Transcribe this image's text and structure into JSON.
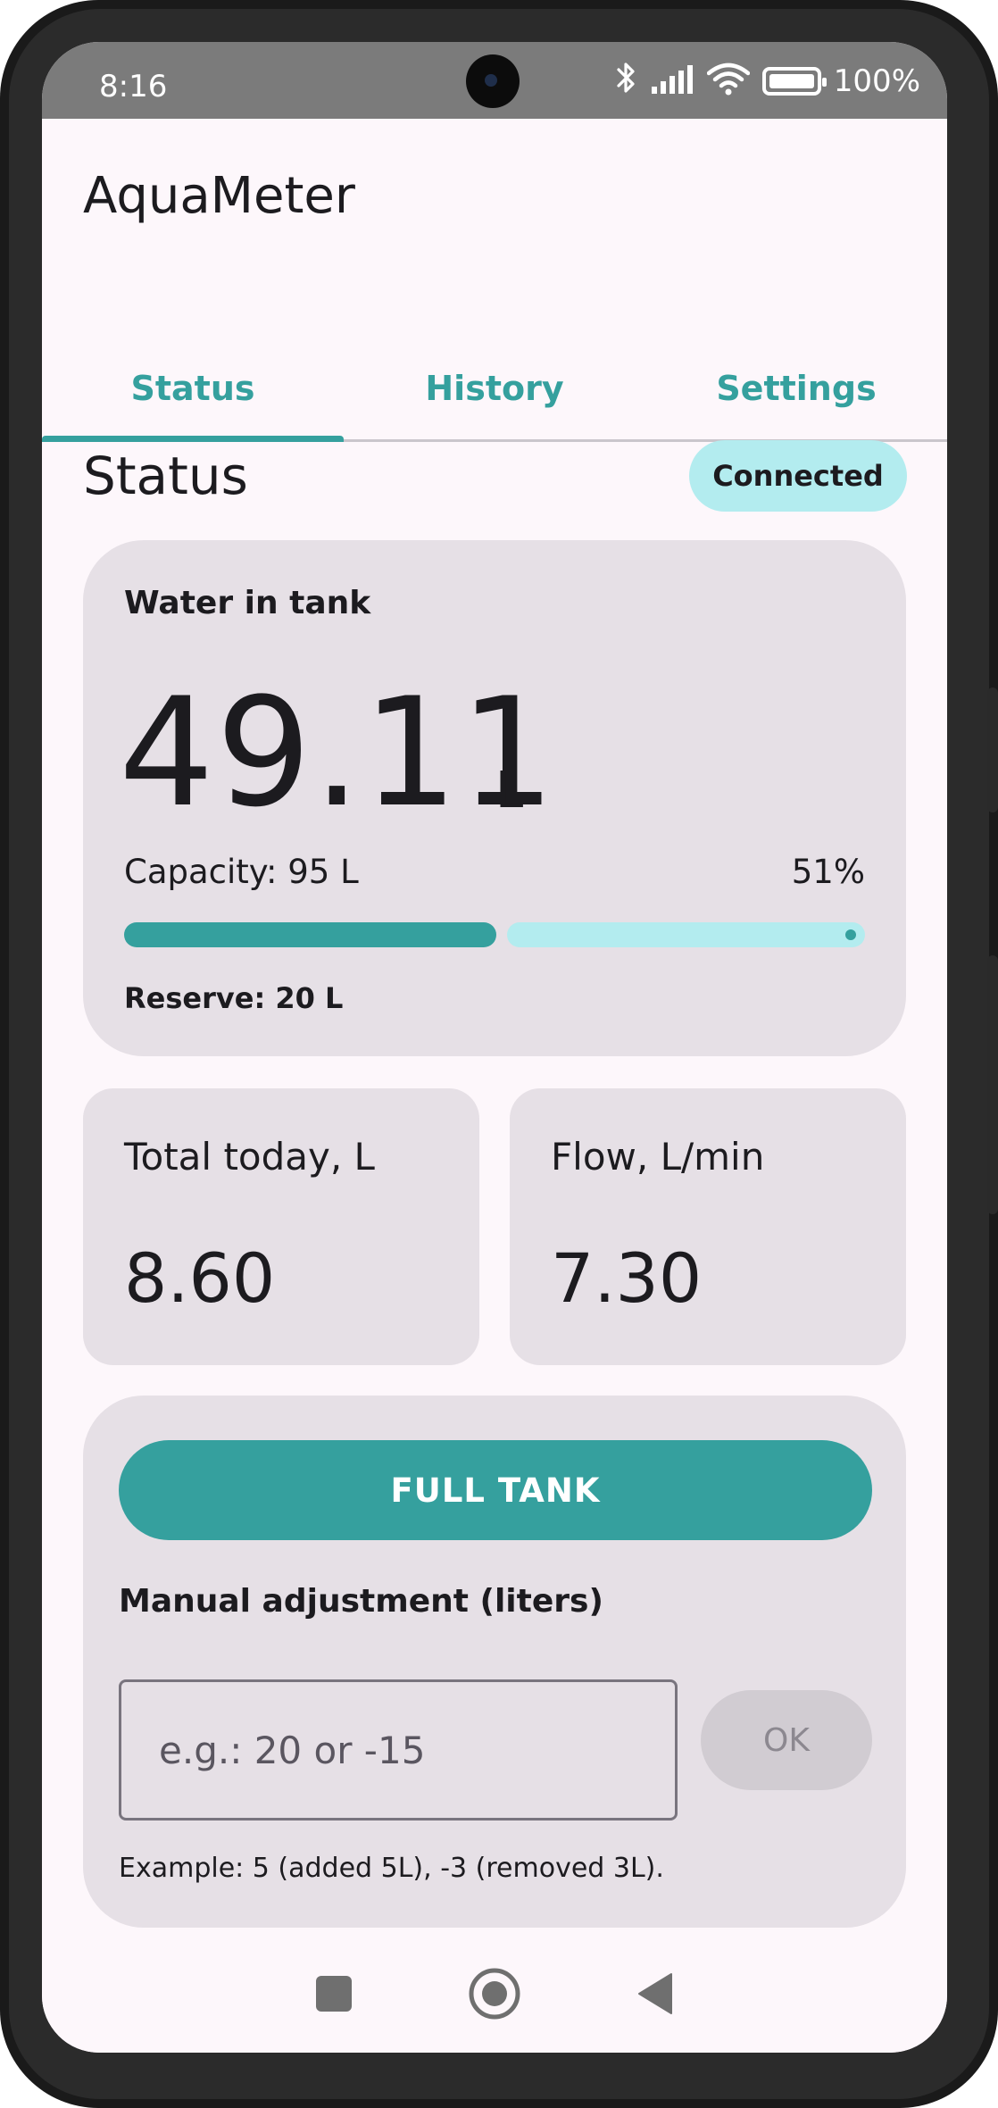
{
  "status_bar": {
    "time": "8:16",
    "battery": "100%"
  },
  "app": {
    "title": "AquaMeter"
  },
  "tabs": [
    {
      "label": "Status",
      "active": true
    },
    {
      "label": "History",
      "active": false
    },
    {
      "label": "Settings",
      "active": false
    }
  ],
  "status": {
    "title": "Status",
    "connection_badge": "Connected"
  },
  "tank": {
    "label": "Water in tank",
    "value": "49.11",
    "unit": "L",
    "capacity_text": "Capacity: 95 L",
    "percent_text": "51%",
    "fill_fraction": 0.51,
    "reserve_text": "Reserve: 20 L"
  },
  "stats": {
    "total_label": "Total today, L",
    "total_value": "8.60",
    "flow_label": "Flow, L/min",
    "flow_value": "7.30"
  },
  "actions": {
    "full_tank_label": "FULL TANK",
    "manual_label": "Manual adjustment (liters)",
    "input_placeholder": "e.g.: 20 or -15",
    "input_value": "",
    "ok_label": "OK",
    "example_text": "Example: 5 (added 5L), -3 (removed 3L)."
  },
  "colors": {
    "accent": "#35a09e",
    "accent_light": "#b3ecef",
    "card": "#e6e0e6",
    "background": "#fdf7fb"
  },
  "navbar": {
    "icons": [
      "recents-square-icon",
      "home-circle-icon",
      "back-triangle-icon"
    ]
  }
}
